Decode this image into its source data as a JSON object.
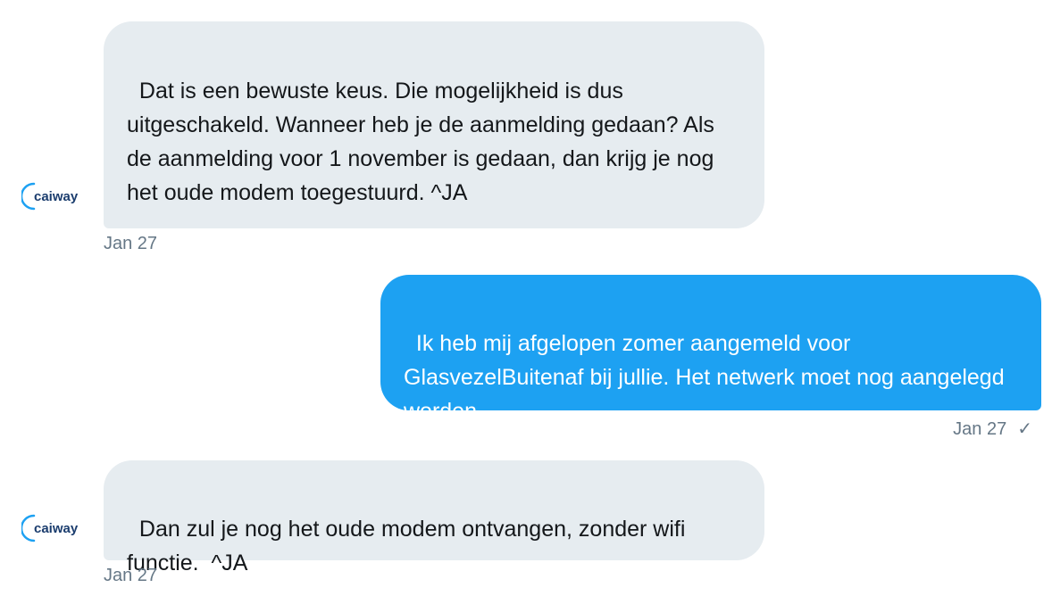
{
  "brand": {
    "name": "caiway",
    "color": "#1b3d6e",
    "accent": "#1da1f2"
  },
  "messages": [
    {
      "direction": "incoming",
      "text": "Dat is een bewuste keus. Die mogelijkheid is dus uitgeschakeld. Wanneer heb je de aanmelding gedaan? Als de aanmelding voor 1 november is gedaan, dan krijg je nog het oude modem toegestuurd. ^JA",
      "date": "Jan 27"
    },
    {
      "direction": "outgoing",
      "text": "Ik heb mij afgelopen zomer aangemeld voor GlasvezelBuitenaf bij jullie. Het netwerk moet nog aangelegd worden.",
      "date": "Jan 27",
      "status_icon": "checkmark-icon"
    },
    {
      "direction": "incoming",
      "text": "Dan zul je nog het oude modem ontvangen, zonder wifi functie.  ^JA",
      "date": "Jan 27"
    }
  ]
}
